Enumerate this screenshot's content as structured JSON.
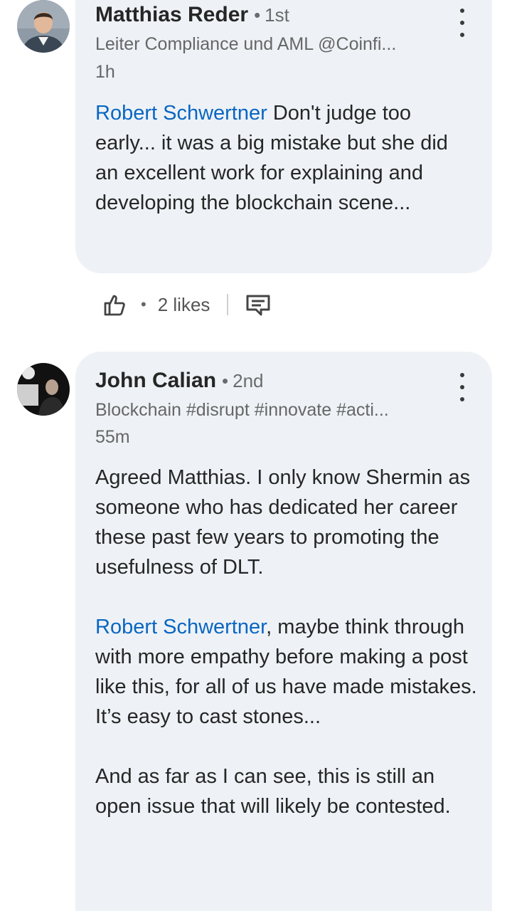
{
  "comments": [
    {
      "author": "Matthias Reder",
      "degree": "1st",
      "headline": "Leiter Compliance und AML @Coinfi...",
      "time": "1h",
      "mention": "Robert Schwertner",
      "text": " Don't judge too early... it was a big mistake but she did an excellent work for explaining and developing the blockchain scene...",
      "likes": "2 likes",
      "avatar_icon": "profile-photo-man-suit"
    },
    {
      "author": "John Calian",
      "degree": "2nd",
      "headline": "Blockchain #disrupt #innovate #acti...",
      "time": "55m",
      "paragraph1": "Agreed Matthias. I only know Shermin as someone who has dedicated her career these past few years to promoting the usefulness of DLT.",
      "mention": "Robert Schwertner",
      "paragraph2_rest": ", maybe think through with more empathy before making a post like this, for all of us have made mistakes. It’s easy to cast stones...",
      "paragraph3": "And as far as I can see, this is still an open issue that will likely be contested.",
      "avatar_icon": "profile-photo-dark"
    }
  ],
  "separator": "•",
  "icons": {
    "more": "more-vertical-icon",
    "like": "thumbs-up-icon",
    "reply": "comment-reply-icon"
  },
  "colors": {
    "mention": "#0a66c2",
    "bubble": "#eef2f6"
  }
}
